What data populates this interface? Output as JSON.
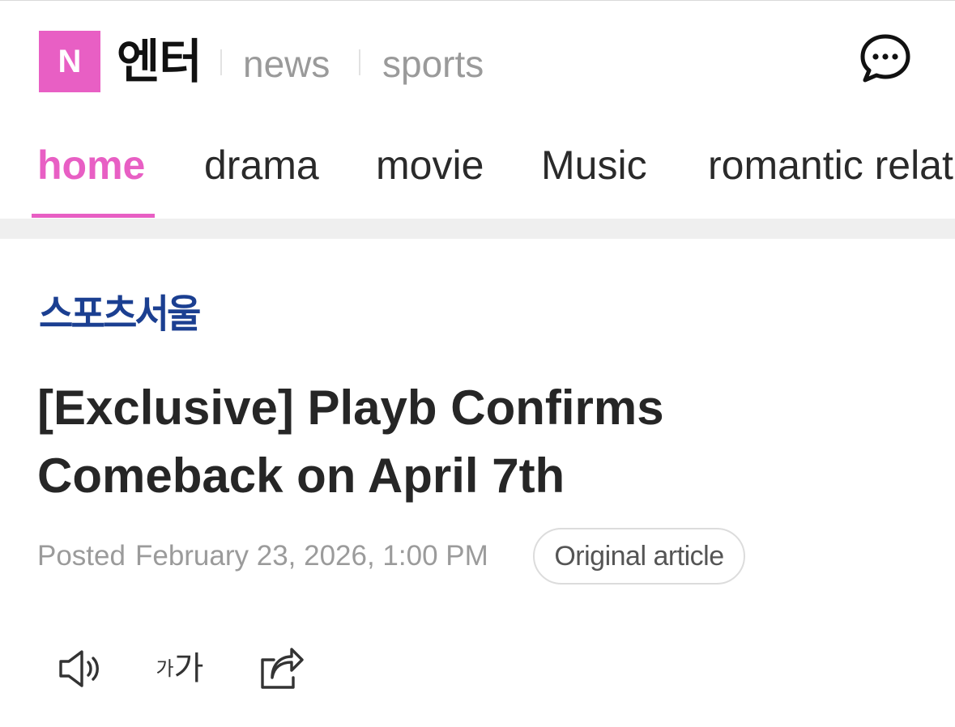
{
  "colors": {
    "accent": "#e85fc4",
    "press_brand": "#1b3f91",
    "divider_band": "#efefef"
  },
  "header": {
    "logo_letter": "N",
    "brand": "엔터",
    "sections": [
      "news",
      "sports"
    ],
    "chat_icon": "chat-bubble-dots-icon"
  },
  "tabs": {
    "items": [
      {
        "label": "home",
        "active": true
      },
      {
        "label": "drama",
        "active": false
      },
      {
        "label": "movie",
        "active": false
      },
      {
        "label": "Music",
        "active": false
      },
      {
        "label": "romantic relat",
        "active": false
      }
    ]
  },
  "article": {
    "press": "스포츠서울",
    "title": "[Exclusive] Playb Confirms Comeback on April 7th",
    "posted_label": "Posted",
    "posted_date": "February 23, 2026, 1:00 PM",
    "original_button": "Original article"
  },
  "toolbar": {
    "tts_icon": "speaker-icon",
    "font_small": "가",
    "font_big": "가",
    "share_icon": "share-icon"
  }
}
